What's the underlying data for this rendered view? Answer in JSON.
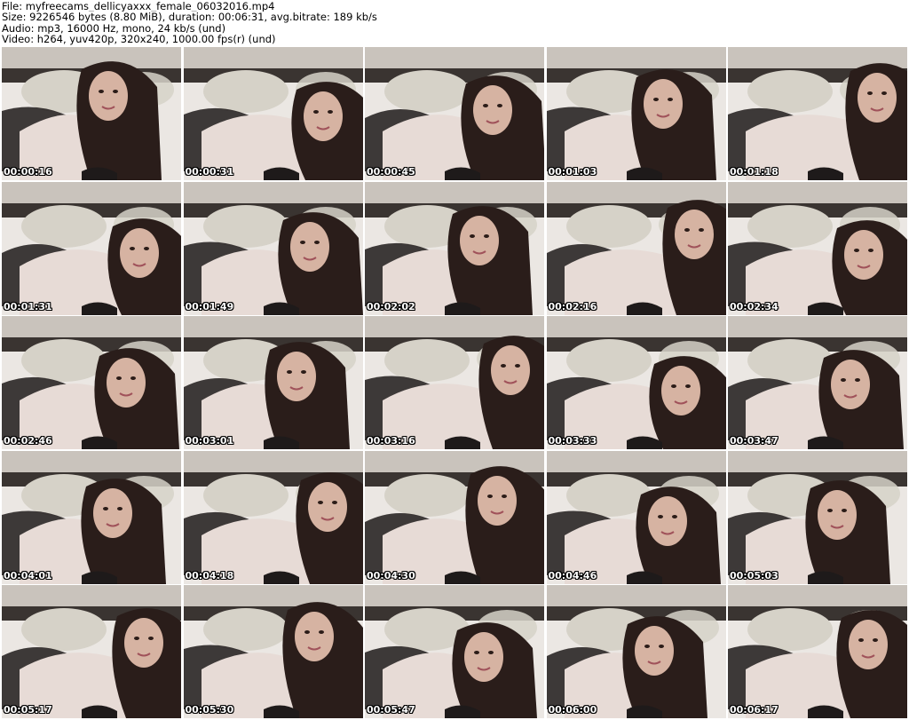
{
  "header": {
    "file_line": "File: myfreecams_dellicyaxxx_female_06032016.mp4",
    "size_line": "Size: 9226546 bytes (8.80 MiB), duration: 00:06:31, avg.bitrate: 189 kb/s",
    "audio_line": "Audio: mp3, 16000 Hz, mono, 24 kb/s (und)",
    "video_line": "Video: h264, yuv420p, 320x240, 1000.00 fps(r) (und)"
  },
  "thumbnails": [
    {
      "timestamp": "00:00:16"
    },
    {
      "timestamp": "00:00:31"
    },
    {
      "timestamp": "00:00:45"
    },
    {
      "timestamp": "00:01:03"
    },
    {
      "timestamp": "00:01:18"
    },
    {
      "timestamp": "00:01:31"
    },
    {
      "timestamp": "00:01:49"
    },
    {
      "timestamp": "00:02:02"
    },
    {
      "timestamp": "00:02:16"
    },
    {
      "timestamp": "00:02:34"
    },
    {
      "timestamp": "00:02:46"
    },
    {
      "timestamp": "00:03:01"
    },
    {
      "timestamp": "00:03:16"
    },
    {
      "timestamp": "00:03:33"
    },
    {
      "timestamp": "00:03:47"
    },
    {
      "timestamp": "00:04:01"
    },
    {
      "timestamp": "00:04:18"
    },
    {
      "timestamp": "00:04:30"
    },
    {
      "timestamp": "00:04:46"
    },
    {
      "timestamp": "00:05:03"
    },
    {
      "timestamp": "00:05:17"
    },
    {
      "timestamp": "00:05:30"
    },
    {
      "timestamp": "00:05:47"
    },
    {
      "timestamp": "00:06:00"
    },
    {
      "timestamp": "00:06:17"
    }
  ],
  "colors": {
    "wall": "#c9c3bc",
    "headboard": "#3a3431",
    "sheet": "#ebe7e3",
    "pillow": "#d6d2c8",
    "robe": "#e7dbd6",
    "hair": "#2a1d1a",
    "skin": "#d6b3a2",
    "lace": "#1e1a1a"
  }
}
